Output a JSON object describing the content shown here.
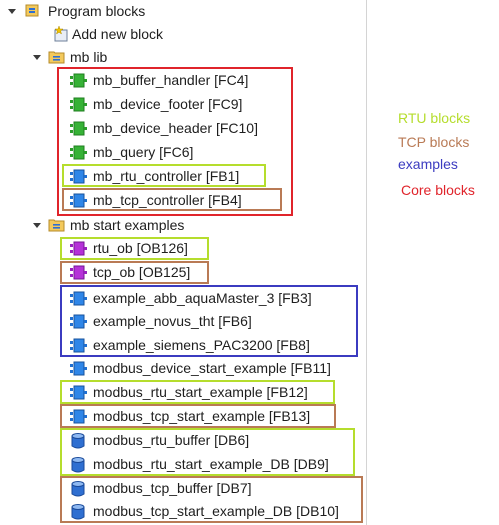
{
  "tree": {
    "root": {
      "label": "Program blocks"
    },
    "add_new": {
      "label": "Add new block"
    },
    "mb_lib": {
      "label": "mb lib",
      "items": [
        {
          "label": "mb_buffer_handler [FC4]"
        },
        {
          "label": "mb_device_footer [FC9]"
        },
        {
          "label": "mb_device_header [FC10]"
        },
        {
          "label": "mb_query [FC6]"
        },
        {
          "label": "mb_rtu_controller [FB1]"
        },
        {
          "label": "mb_tcp_controller [FB4]"
        }
      ]
    },
    "mb_start": {
      "label": "mb start examples",
      "items": [
        {
          "label": "rtu_ob [OB126]"
        },
        {
          "label": "tcp_ob [OB125]"
        },
        {
          "label": "example_abb_aquaMaster_3 [FB3]"
        },
        {
          "label": "example_novus_tht [FB6]"
        },
        {
          "label": "example_siemens_PAC3200 [FB8]"
        },
        {
          "label": "modbus_device_start_example [FB11]"
        },
        {
          "label": "modbus_rtu_start_example [FB12]"
        },
        {
          "label": "modbus_tcp_start_example [FB13]"
        },
        {
          "label": "modbus_rtu_buffer [DB6]"
        },
        {
          "label": "modbus_rtu_start_example_DB [DB9]"
        },
        {
          "label": "modbus_tcp_buffer [DB7]"
        },
        {
          "label": "modbus_tcp_start_example_DB [DB10]"
        }
      ]
    }
  },
  "legend": {
    "rtu": {
      "label": "RTU blocks",
      "color": "#b5dd2d"
    },
    "tcp": {
      "label": "TCP blocks",
      "color": "#b97a55"
    },
    "examples": {
      "label": "examples",
      "color": "#3b3bc0"
    },
    "core": {
      "label": "Core blocks",
      "color": "#e0242b"
    }
  }
}
